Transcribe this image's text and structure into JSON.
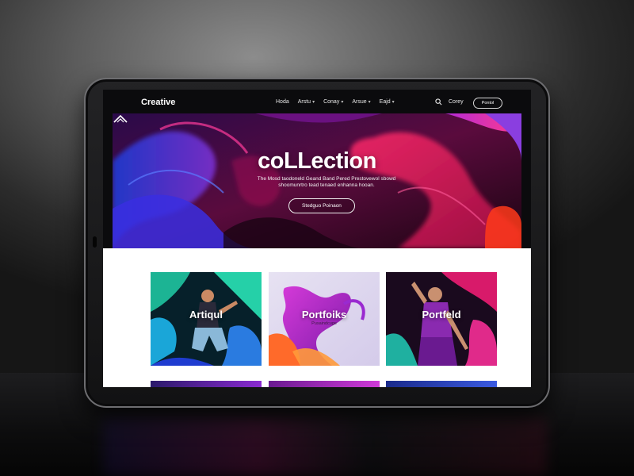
{
  "site": {
    "logo": "Creative"
  },
  "nav": {
    "links": [
      {
        "label": "Hoda",
        "has_chevron": false
      },
      {
        "label": "Arstu",
        "has_chevron": true
      },
      {
        "label": "Conay",
        "has_chevron": true
      },
      {
        "label": "Arsue",
        "has_chevron": true
      },
      {
        "label": "Eajd",
        "has_chevron": true
      }
    ],
    "search_icon": "search-icon",
    "contact": "Corey",
    "cta": "Pontol"
  },
  "hero": {
    "title": "coLLection",
    "subtitle": "The Mosd taodoneld Geand Band Pered Prestovewol sbowd shoomunrtro tead tenaed enhanna hooan.",
    "button": "Stedguo Poinaon",
    "scroll_icon": "chevron-up-icon"
  },
  "gallery": {
    "cards": [
      {
        "title": "Artiqul",
        "subtitle": ""
      },
      {
        "title": "Portfoiks",
        "subtitle": "Pusaindcuge"
      },
      {
        "title": "Portfeld",
        "subtitle": ""
      }
    ]
  },
  "colors": {
    "accent_magenta": "#e0207a",
    "accent_purple": "#7b2fd0",
    "accent_blue": "#2c4fd8",
    "screen_bg": "#0b0b0d"
  }
}
